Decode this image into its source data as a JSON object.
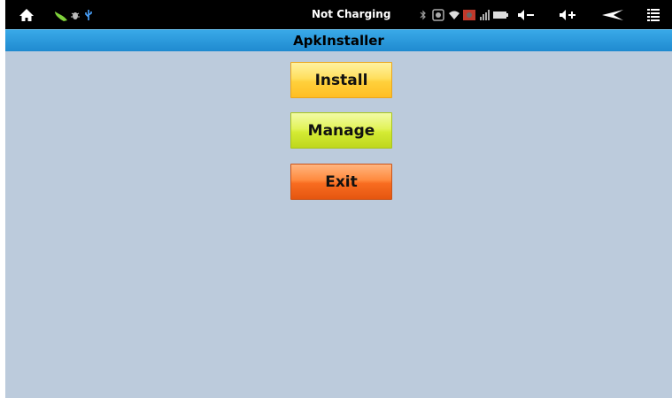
{
  "status_bar": {
    "charging_text": "Not Charging",
    "icons": [
      "home-icon",
      "android-icon",
      "bug-icon",
      "usb-icon",
      "bluetooth-icon",
      "sync-icon",
      "wifi-icon",
      "alert-icon",
      "signal-icon",
      "battery-icon",
      "volume-down-icon",
      "volume-up-icon",
      "back-icon",
      "menu-icon"
    ]
  },
  "app": {
    "title": "ApkInstaller"
  },
  "buttons": {
    "install": "Install",
    "manage": "Manage",
    "exit": "Exit"
  },
  "colors": {
    "title_bar": "#2196dc",
    "background": "#bccbdc",
    "install": "#ffd03c",
    "manage": "#d4eb34",
    "exit": "#f86c20"
  }
}
